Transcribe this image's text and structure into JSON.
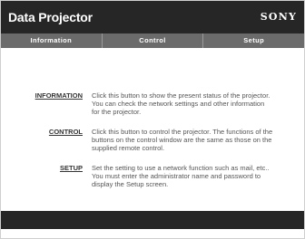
{
  "header": {
    "title": "Data Projector",
    "brand": "SONY"
  },
  "tabs": [
    {
      "label": "Information"
    },
    {
      "label": "Control"
    },
    {
      "label": "Setup"
    }
  ],
  "menu": [
    {
      "link": "INFORMATION",
      "description": "Click this button to show the present status of the projector. You can check the network settings and other information for the projector."
    },
    {
      "link": "CONTROL",
      "description": "Click this button to control the projector. The functions of the buttons on the control window are the same as those on the supplied remote control."
    },
    {
      "link": "SETUP",
      "description": "Set the setting to use a network function such as mail, etc.. You must enter the administrator name and password to display the Setup screen."
    }
  ],
  "colors": {
    "header_bg": "#262626",
    "tab_bg": "#6b6b6b",
    "text": "#555555"
  }
}
